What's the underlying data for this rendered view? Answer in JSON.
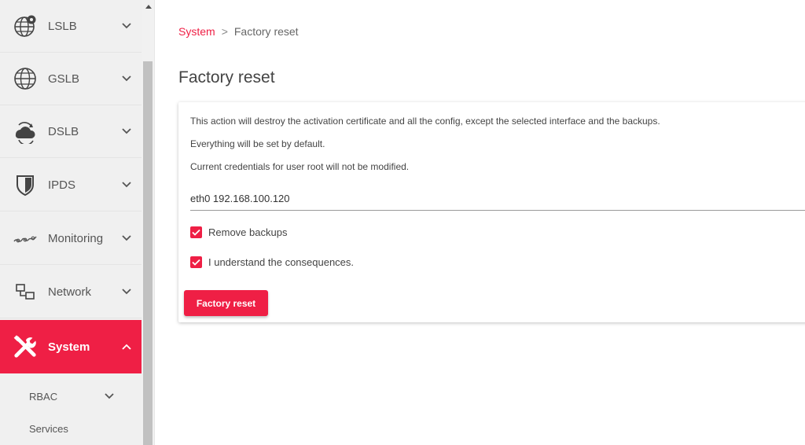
{
  "sidebar": {
    "items": [
      {
        "label": "LSLB",
        "icon": "globe-pin-icon"
      },
      {
        "label": "GSLB",
        "icon": "globe-icon"
      },
      {
        "label": "DSLB",
        "icon": "cloud-sync-icon"
      },
      {
        "label": "IPDS",
        "icon": "shield-icon"
      },
      {
        "label": "Monitoring",
        "icon": "monitoring-wave-icon"
      },
      {
        "label": "Network",
        "icon": "network-icon"
      },
      {
        "label": "System",
        "icon": "tools-icon",
        "active": true
      }
    ],
    "sub_items": [
      {
        "label": "RBAC"
      },
      {
        "label": "Services"
      }
    ]
  },
  "breadcrumb": {
    "parent": "System",
    "separator": ">",
    "current": "Factory reset"
  },
  "page_title": "Factory reset",
  "card": {
    "lines": [
      "This action will destroy the activation certificate and all the config, except the selected interface and the backups.",
      "Everything will be set by default.",
      "Current credentials for user root will not be modified."
    ],
    "interface_value": "eth0 192.168.100.120",
    "remove_backups_label": "Remove backups",
    "remove_backups_checked": true,
    "understand_label": "I understand the consequences.",
    "understand_checked": true,
    "button_label": "Factory reset"
  },
  "colors": {
    "accent": "#ef1f45",
    "sidebar_bg": "#f0f0f0"
  }
}
